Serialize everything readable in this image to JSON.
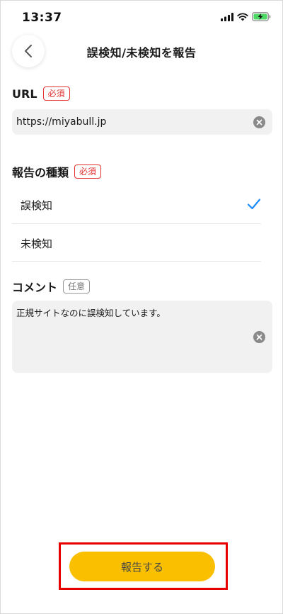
{
  "status_bar": {
    "time": "13:37"
  },
  "header": {
    "title": "誤検知/未検知を報告"
  },
  "url_section": {
    "label": "URL",
    "badge": "必須",
    "value": "https://miyabull.jp"
  },
  "report_type_section": {
    "label": "報告の種類",
    "badge": "必須",
    "options": [
      {
        "label": "誤検知",
        "selected": true
      },
      {
        "label": "未検知",
        "selected": false
      }
    ]
  },
  "comment_section": {
    "label": "コメント",
    "badge": "任意",
    "value": "正規サイトなのに誤検知しています。"
  },
  "submit": {
    "label": "報告する"
  },
  "colors": {
    "accent": "#fac000",
    "required_badge": "#e2312f",
    "check": "#1a8cff",
    "highlight": "#e60000"
  }
}
